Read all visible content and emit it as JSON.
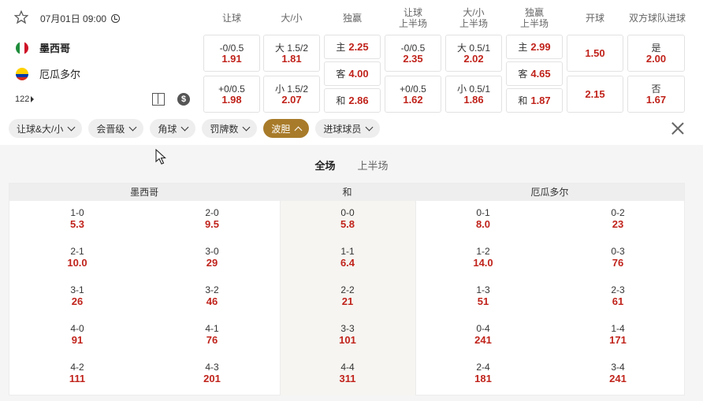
{
  "match": {
    "datetime": "07月01日 09:00",
    "home": "墨西哥",
    "away": "厄瓜多尔",
    "more_count": "122",
    "flag_colors": {
      "mexico": [
        "#1f8c3b",
        "#ffffff",
        "#ce1126"
      ],
      "ecuador": [
        "#ffd100",
        "#0038a8",
        "#d52b1e"
      ]
    }
  },
  "columns": [
    {
      "l1": "让球",
      "l2": ""
    },
    {
      "l1": "大/小",
      "l2": ""
    },
    {
      "l1": "独赢",
      "l2": ""
    },
    {
      "l1": "让球",
      "l2": "上半场"
    },
    {
      "l1": "大/小",
      "l2": "上半场"
    },
    {
      "l1": "独赢",
      "l2": "上半场"
    },
    {
      "l1": "开球",
      "l2": ""
    },
    {
      "l1": "双方球队进球",
      "l2": ""
    }
  ],
  "odds": {
    "handicap": [
      {
        "label": "-0/0.5",
        "value": "1.91"
      },
      {
        "label": "+0/0.5",
        "value": "1.98"
      }
    ],
    "ou": [
      {
        "label": "大 1.5/2",
        "value": "1.81"
      },
      {
        "label": "小 1.5/2",
        "value": "2.07"
      }
    ],
    "moneyline": [
      {
        "label": "主",
        "value": "2.25"
      },
      {
        "label": "客",
        "value": "4.00"
      },
      {
        "label": "和",
        "value": "2.86"
      }
    ],
    "handicap_h1": [
      {
        "label": "-0/0.5",
        "value": "2.35"
      },
      {
        "label": "+0/0.5",
        "value": "1.62"
      }
    ],
    "ou_h1": [
      {
        "label": "大 0.5/1",
        "value": "2.02"
      },
      {
        "label": "小 0.5/1",
        "value": "1.86"
      }
    ],
    "moneyline_h1": [
      {
        "label": "主",
        "value": "2.99"
      },
      {
        "label": "客",
        "value": "4.65"
      },
      {
        "label": "和",
        "value": "1.87"
      }
    ],
    "kickoff": [
      {
        "value": "1.50"
      },
      {
        "value": "2.15"
      }
    ],
    "btts": [
      {
        "label": "是",
        "value": "2.00"
      },
      {
        "label": "否",
        "value": "1.67"
      }
    ]
  },
  "filters": [
    "让球&大/小",
    "会晋级",
    "角球",
    "罚牌数",
    "波胆",
    "进球球员"
  ],
  "active_filter": "波胆",
  "tabs": [
    "全场",
    "上半场"
  ],
  "board": {
    "headers": [
      "墨西哥",
      "和",
      "厄瓜多尔"
    ],
    "home": [
      {
        "score": "1-0",
        "odds": "5.3"
      },
      {
        "score": "2-0",
        "odds": "9.5"
      },
      {
        "score": "2-1",
        "odds": "10.0"
      },
      {
        "score": "3-0",
        "odds": "29"
      },
      {
        "score": "3-1",
        "odds": "26"
      },
      {
        "score": "3-2",
        "odds": "46"
      },
      {
        "score": "4-0",
        "odds": "91"
      },
      {
        "score": "4-1",
        "odds": "76"
      },
      {
        "score": "4-2",
        "odds": "111"
      },
      {
        "score": "4-3",
        "odds": "201"
      }
    ],
    "draw": [
      {
        "score": "0-0",
        "odds": "5.8"
      },
      {
        "score": "1-1",
        "odds": "6.4"
      },
      {
        "score": "2-2",
        "odds": "21"
      },
      {
        "score": "3-3",
        "odds": "101"
      },
      {
        "score": "4-4",
        "odds": "311"
      }
    ],
    "away": [
      {
        "score": "0-1",
        "odds": "8.0"
      },
      {
        "score": "0-2",
        "odds": "23"
      },
      {
        "score": "1-2",
        "odds": "14.0"
      },
      {
        "score": "0-3",
        "odds": "76"
      },
      {
        "score": "1-3",
        "odds": "51"
      },
      {
        "score": "2-3",
        "odds": "61"
      },
      {
        "score": "0-4",
        "odds": "241"
      },
      {
        "score": "1-4",
        "odds": "171"
      },
      {
        "score": "2-4",
        "odds": "181"
      },
      {
        "score": "3-4",
        "odds": "241"
      }
    ]
  }
}
